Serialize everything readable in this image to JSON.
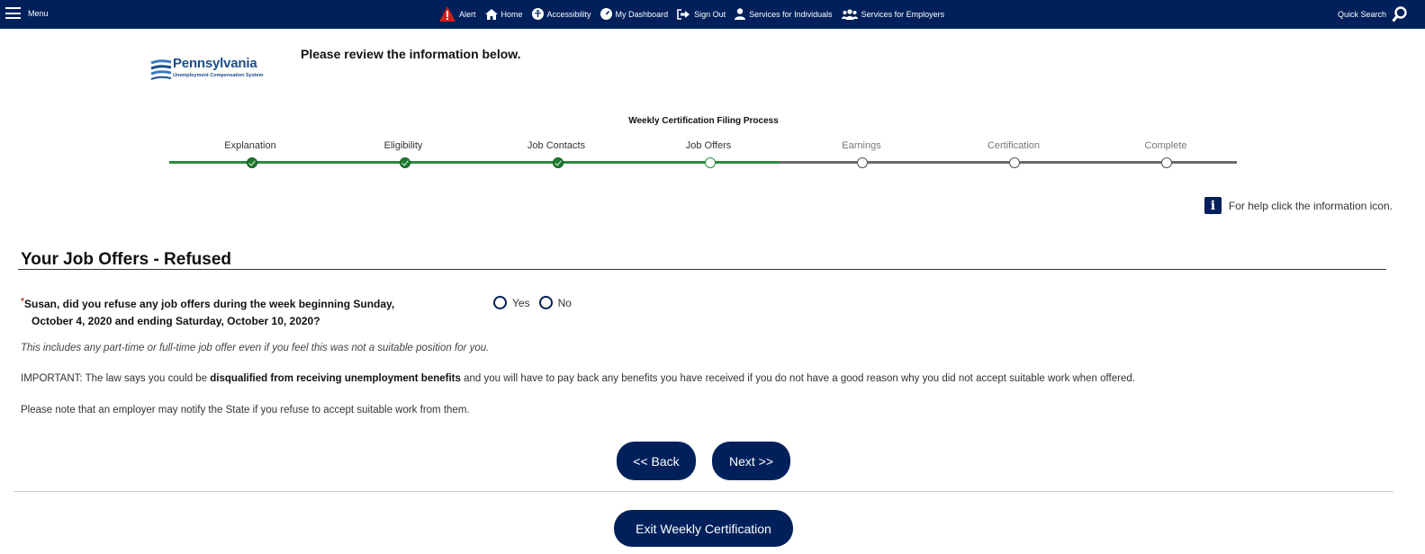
{
  "topbar": {
    "menu_label": "Menu",
    "nav": [
      {
        "label": "Alert",
        "icon": "alert-icon"
      },
      {
        "label": "Home",
        "icon": "home-icon"
      },
      {
        "label": "Accessibility",
        "icon": "accessibility-icon"
      },
      {
        "label": "My Dashboard",
        "icon": "dashboard-icon"
      },
      {
        "label": "Sign Out",
        "icon": "sign-out-icon"
      },
      {
        "label": "Services for Individuals",
        "icon": "person-icon"
      },
      {
        "label": "Services for Employers",
        "icon": "group-icon"
      }
    ],
    "quick_search_label": "Quick Search",
    "bar_color": "#00205b"
  },
  "logo": {
    "title": "Pennsylvania",
    "subtitle": "Unemployment Compensation System"
  },
  "page": {
    "review_heading": "Please review the information below."
  },
  "progress": {
    "title": "Weekly Certification Filing Process",
    "steps": [
      {
        "label": "Explanation",
        "status": "complete"
      },
      {
        "label": "Eligibility",
        "status": "complete"
      },
      {
        "label": "Job Contacts",
        "status": "complete"
      },
      {
        "label": "Job Offers",
        "status": "current"
      },
      {
        "label": "Earnings",
        "status": "pending"
      },
      {
        "label": "Certification",
        "status": "pending"
      },
      {
        "label": "Complete",
        "status": "pending"
      }
    ],
    "complete_color": "#2a8a3c",
    "pending_color": "#6b6b6b"
  },
  "help": {
    "text": "For help click the information icon."
  },
  "section": {
    "title": "Your Job Offers - Refused",
    "required_marker": "*",
    "question_line1": "Susan, did you refuse any job offers during the week beginning Sunday,",
    "question_line2": "October 4, 2020 and ending Saturday, October 10, 2020?",
    "options": [
      "Yes",
      "No"
    ],
    "note": "This includes any part-time or full-time job offer even if you feel this was not a suitable position for you.",
    "important_prefix": "IMPORTANT: The law says you could be ",
    "important_bold": "disqualified from receiving unemployment benefits",
    "important_suffix": " and you will have to pay back any benefits you have received if you do not have a good reason why you did not accept suitable work when offered.",
    "notify": "Please note that an employer may notify the State if you refuse to accept suitable work from them."
  },
  "buttons": {
    "back": "<< Back",
    "next": "Next >>",
    "exit": "Exit Weekly Certification"
  }
}
